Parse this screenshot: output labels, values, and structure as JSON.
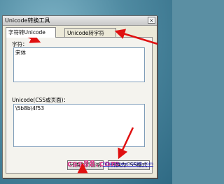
{
  "window": {
    "title": "Unicode转换工具",
    "close_glyph": "×"
  },
  "tabs": [
    {
      "label": "字符转Unicode",
      "active": true
    },
    {
      "label": "Unicode转字符",
      "active": false
    }
  ],
  "input": {
    "label": "字符：",
    "value": "宋体"
  },
  "output": {
    "label": "Unicode(CSS或页面)：",
    "value": "\\5b8b\\4f53"
  },
  "buttons": {
    "page_format": "转换为页面格",
    "css_format": "转换为CSS格式"
  },
  "watermark": "css88.com",
  "site_link": "http://www.css88.com",
  "colors": {
    "arrow": "#e01010",
    "watermark": "#d83f8c"
  }
}
